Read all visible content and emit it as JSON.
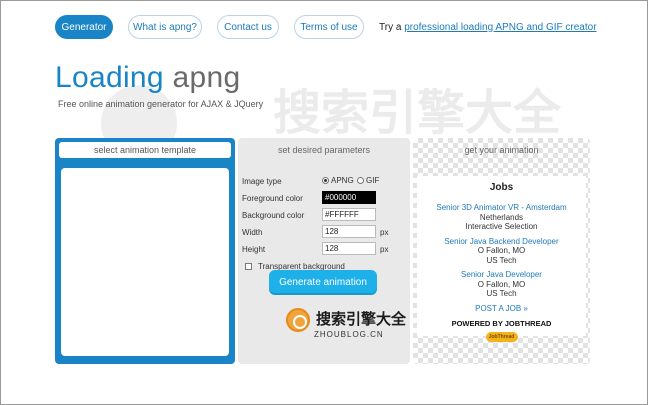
{
  "nav": {
    "items": [
      {
        "label": "Generator"
      },
      {
        "label": "What is apng?"
      },
      {
        "label": "Contact us"
      },
      {
        "label": "Terms of use"
      }
    ],
    "promo_prefix": "Try a",
    "promo_link": "professional loading APNG and GIF creator"
  },
  "header": {
    "title_part1": "Loading",
    "title_part2": "apng",
    "subtitle": "Free online animation generator for AJAX & JQuery"
  },
  "watermark": {
    "text": "搜索引擎大全",
    "subtext": "ZHOUBLOG.CN"
  },
  "panels": {
    "template_header": "select animation template",
    "params_header": "set desired parameters",
    "result_header": "get your animation"
  },
  "params": {
    "image_type_label": "Image type",
    "image_type_options": [
      "APNG",
      "GIF"
    ],
    "image_type_selected": "APNG",
    "fg_label": "Foreground color",
    "fg_value": "#000000",
    "bg_label": "Background color",
    "bg_value": "#FFFFFF",
    "width_label": "Width",
    "width_value": "128",
    "height_label": "Height",
    "height_value": "128",
    "unit": "px",
    "transparent_label": "Transparent background",
    "generate_label": "Generate animation"
  },
  "brand": {
    "text_cn": "搜索引擎大全",
    "text_en": "ZHOUBLOG.CN"
  },
  "jobs": {
    "title": "Jobs",
    "items": [
      {
        "title": "Senior 3D Animator VR - Amsterdam",
        "line1": "Netherlands",
        "line2": "Interactive Selection"
      },
      {
        "title": "Senior Java Backend Developer",
        "line1": "O Fallon, MO",
        "line2": "US Tech"
      },
      {
        "title": "Senior Java Developer",
        "line1": "O Fallon, MO",
        "line2": "US Tech"
      }
    ],
    "post_link": "POST A JOB »",
    "powered": "POWERED BY JOBTHREAD",
    "logo_text": "JobThread"
  },
  "colors": {
    "accent": "#1a85c6",
    "button": "#1eb0e8"
  }
}
